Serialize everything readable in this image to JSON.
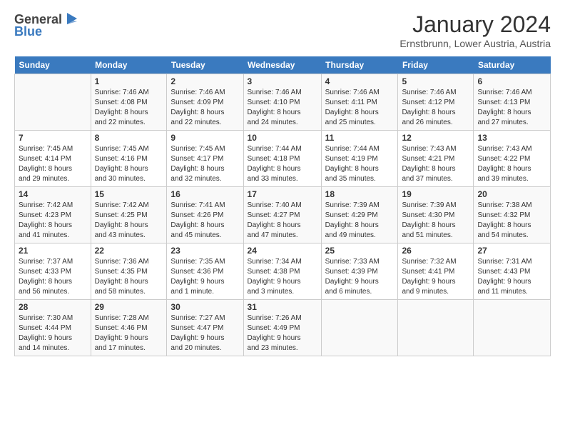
{
  "logo": {
    "general": "General",
    "blue": "Blue"
  },
  "header": {
    "month_year": "January 2024",
    "location": "Ernstbrunn, Lower Austria, Austria"
  },
  "days_of_week": [
    "Sunday",
    "Monday",
    "Tuesday",
    "Wednesday",
    "Thursday",
    "Friday",
    "Saturday"
  ],
  "weeks": [
    [
      {
        "day": "",
        "sunrise": "",
        "sunset": "",
        "daylight": ""
      },
      {
        "day": "1",
        "sunrise": "Sunrise: 7:46 AM",
        "sunset": "Sunset: 4:08 PM",
        "daylight": "Daylight: 8 hours and 22 minutes."
      },
      {
        "day": "2",
        "sunrise": "Sunrise: 7:46 AM",
        "sunset": "Sunset: 4:09 PM",
        "daylight": "Daylight: 8 hours and 22 minutes."
      },
      {
        "day": "3",
        "sunrise": "Sunrise: 7:46 AM",
        "sunset": "Sunset: 4:10 PM",
        "daylight": "Daylight: 8 hours and 24 minutes."
      },
      {
        "day": "4",
        "sunrise": "Sunrise: 7:46 AM",
        "sunset": "Sunset: 4:11 PM",
        "daylight": "Daylight: 8 hours and 25 minutes."
      },
      {
        "day": "5",
        "sunrise": "Sunrise: 7:46 AM",
        "sunset": "Sunset: 4:12 PM",
        "daylight": "Daylight: 8 hours and 26 minutes."
      },
      {
        "day": "6",
        "sunrise": "Sunrise: 7:46 AM",
        "sunset": "Sunset: 4:13 PM",
        "daylight": "Daylight: 8 hours and 27 minutes."
      }
    ],
    [
      {
        "day": "7",
        "sunrise": "Sunrise: 7:45 AM",
        "sunset": "Sunset: 4:14 PM",
        "daylight": "Daylight: 8 hours and 29 minutes."
      },
      {
        "day": "8",
        "sunrise": "Sunrise: 7:45 AM",
        "sunset": "Sunset: 4:16 PM",
        "daylight": "Daylight: 8 hours and 30 minutes."
      },
      {
        "day": "9",
        "sunrise": "Sunrise: 7:45 AM",
        "sunset": "Sunset: 4:17 PM",
        "daylight": "Daylight: 8 hours and 32 minutes."
      },
      {
        "day": "10",
        "sunrise": "Sunrise: 7:44 AM",
        "sunset": "Sunset: 4:18 PM",
        "daylight": "Daylight: 8 hours and 33 minutes."
      },
      {
        "day": "11",
        "sunrise": "Sunrise: 7:44 AM",
        "sunset": "Sunset: 4:19 PM",
        "daylight": "Daylight: 8 hours and 35 minutes."
      },
      {
        "day": "12",
        "sunrise": "Sunrise: 7:43 AM",
        "sunset": "Sunset: 4:21 PM",
        "daylight": "Daylight: 8 hours and 37 minutes."
      },
      {
        "day": "13",
        "sunrise": "Sunrise: 7:43 AM",
        "sunset": "Sunset: 4:22 PM",
        "daylight": "Daylight: 8 hours and 39 minutes."
      }
    ],
    [
      {
        "day": "14",
        "sunrise": "Sunrise: 7:42 AM",
        "sunset": "Sunset: 4:23 PM",
        "daylight": "Daylight: 8 hours and 41 minutes."
      },
      {
        "day": "15",
        "sunrise": "Sunrise: 7:42 AM",
        "sunset": "Sunset: 4:25 PM",
        "daylight": "Daylight: 8 hours and 43 minutes."
      },
      {
        "day": "16",
        "sunrise": "Sunrise: 7:41 AM",
        "sunset": "Sunset: 4:26 PM",
        "daylight": "Daylight: 8 hours and 45 minutes."
      },
      {
        "day": "17",
        "sunrise": "Sunrise: 7:40 AM",
        "sunset": "Sunset: 4:27 PM",
        "daylight": "Daylight: 8 hours and 47 minutes."
      },
      {
        "day": "18",
        "sunrise": "Sunrise: 7:39 AM",
        "sunset": "Sunset: 4:29 PM",
        "daylight": "Daylight: 8 hours and 49 minutes."
      },
      {
        "day": "19",
        "sunrise": "Sunrise: 7:39 AM",
        "sunset": "Sunset: 4:30 PM",
        "daylight": "Daylight: 8 hours and 51 minutes."
      },
      {
        "day": "20",
        "sunrise": "Sunrise: 7:38 AM",
        "sunset": "Sunset: 4:32 PM",
        "daylight": "Daylight: 8 hours and 54 minutes."
      }
    ],
    [
      {
        "day": "21",
        "sunrise": "Sunrise: 7:37 AM",
        "sunset": "Sunset: 4:33 PM",
        "daylight": "Daylight: 8 hours and 56 minutes."
      },
      {
        "day": "22",
        "sunrise": "Sunrise: 7:36 AM",
        "sunset": "Sunset: 4:35 PM",
        "daylight": "Daylight: 8 hours and 58 minutes."
      },
      {
        "day": "23",
        "sunrise": "Sunrise: 7:35 AM",
        "sunset": "Sunset: 4:36 PM",
        "daylight": "Daylight: 9 hours and 1 minute."
      },
      {
        "day": "24",
        "sunrise": "Sunrise: 7:34 AM",
        "sunset": "Sunset: 4:38 PM",
        "daylight": "Daylight: 9 hours and 3 minutes."
      },
      {
        "day": "25",
        "sunrise": "Sunrise: 7:33 AM",
        "sunset": "Sunset: 4:39 PM",
        "daylight": "Daylight: 9 hours and 6 minutes."
      },
      {
        "day": "26",
        "sunrise": "Sunrise: 7:32 AM",
        "sunset": "Sunset: 4:41 PM",
        "daylight": "Daylight: 9 hours and 9 minutes."
      },
      {
        "day": "27",
        "sunrise": "Sunrise: 7:31 AM",
        "sunset": "Sunset: 4:43 PM",
        "daylight": "Daylight: 9 hours and 11 minutes."
      }
    ],
    [
      {
        "day": "28",
        "sunrise": "Sunrise: 7:30 AM",
        "sunset": "Sunset: 4:44 PM",
        "daylight": "Daylight: 9 hours and 14 minutes."
      },
      {
        "day": "29",
        "sunrise": "Sunrise: 7:28 AM",
        "sunset": "Sunset: 4:46 PM",
        "daylight": "Daylight: 9 hours and 17 minutes."
      },
      {
        "day": "30",
        "sunrise": "Sunrise: 7:27 AM",
        "sunset": "Sunset: 4:47 PM",
        "daylight": "Daylight: 9 hours and 20 minutes."
      },
      {
        "day": "31",
        "sunrise": "Sunrise: 7:26 AM",
        "sunset": "Sunset: 4:49 PM",
        "daylight": "Daylight: 9 hours and 23 minutes."
      },
      {
        "day": "",
        "sunrise": "",
        "sunset": "",
        "daylight": ""
      },
      {
        "day": "",
        "sunrise": "",
        "sunset": "",
        "daylight": ""
      },
      {
        "day": "",
        "sunrise": "",
        "sunset": "",
        "daylight": ""
      }
    ]
  ]
}
